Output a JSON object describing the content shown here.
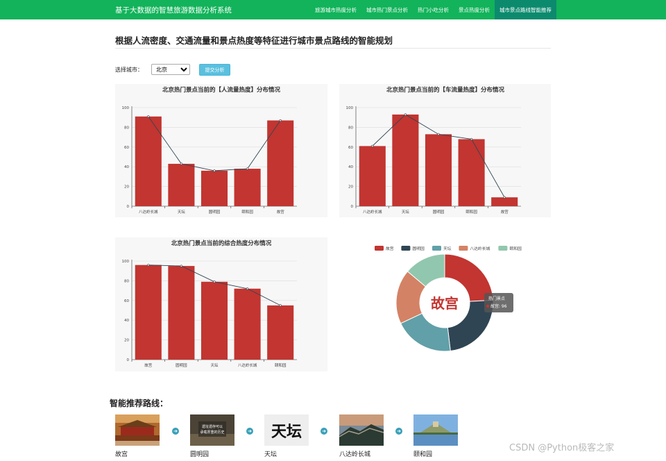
{
  "navbar": {
    "brand": "基于大数据的智慧旅游数据分析系统",
    "items": [
      {
        "label": "旅游城市热度分析"
      },
      {
        "label": "城市热门景点分析"
      },
      {
        "label": "热门小吃分析"
      },
      {
        "label": "景点热度分析"
      },
      {
        "label": "城市景点路线智能推荐"
      }
    ],
    "active_index": 4
  },
  "page": {
    "title": "根据人流密度、交通流量和景点热度等特征进行城市景点路线的智能规划"
  },
  "form": {
    "label": "选择城市：",
    "selected_city": "北京",
    "submit_label": "提交分析"
  },
  "chart_data": [
    {
      "type": "bar",
      "title": "北京热门景点当前的【人流量热度】分布情况",
      "categories": [
        "八达岭长城",
        "天坛",
        "圆明园",
        "颐和园",
        "故宫"
      ],
      "values": [
        91,
        43,
        36,
        38,
        87
      ],
      "ylim": [
        0,
        100
      ],
      "yticks": [
        0,
        20,
        40,
        60,
        80,
        100
      ],
      "overlay": "line",
      "bar_color": "#c23531",
      "line_color": "#2f4554",
      "grid": true
    },
    {
      "type": "bar",
      "title": "北京热门景点当前的【车流量热度】分布情况",
      "categories": [
        "八达岭长城",
        "天坛",
        "圆明园",
        "颐和园",
        "故宫"
      ],
      "values": [
        61,
        93,
        73,
        68,
        9
      ],
      "ylim": [
        0,
        100
      ],
      "yticks": [
        0,
        20,
        40,
        60,
        80,
        100
      ],
      "overlay": "line",
      "bar_color": "#c23531",
      "line_color": "#2f4554",
      "grid": true
    },
    {
      "type": "bar",
      "title": "北京热门景点当前的综合热度分布情况",
      "categories": [
        "故宫",
        "圆明园",
        "天坛",
        "八达岭长城",
        "颐和园"
      ],
      "values": [
        96,
        95,
        79,
        72,
        55
      ],
      "ylim": [
        0,
        100
      ],
      "yticks": [
        0,
        20,
        40,
        60,
        80,
        100
      ],
      "overlay": "line",
      "bar_color": "#c23531",
      "line_color": "#2f4554",
      "grid": true
    },
    {
      "type": "pie",
      "style": "donut",
      "legend": [
        "故宫",
        "圆明园",
        "天坛",
        "八达岭长城",
        "颐和园"
      ],
      "legend_position": "top",
      "values": [
        96,
        95,
        79,
        72,
        55
      ],
      "colors": [
        "#c23531",
        "#2f4554",
        "#61a0a8",
        "#d48265",
        "#91c7ae"
      ],
      "center_label": "故宫",
      "tooltip": {
        "title": "热门景点",
        "text": "故宫: 96"
      }
    }
  ],
  "route": {
    "title": "智能推荐路线：",
    "stops": [
      {
        "name": "故宫",
        "image": "forbidden-city-photo"
      },
      {
        "name": "圆明园",
        "image": "yuanmingyuan-photo",
        "overlay": "遗址遗存可以\n承载厚重的历史"
      },
      {
        "name": "天坛",
        "image": "temple-of-heaven-photo",
        "overlay": "天坛"
      },
      {
        "name": "八达岭长城",
        "image": "great-wall-photo"
      },
      {
        "name": "颐和园",
        "image": "summer-palace-photo"
      }
    ],
    "arrow_icon": "arrow-right-circle-icon"
  },
  "watermark": "CSDN @Python极客之家"
}
